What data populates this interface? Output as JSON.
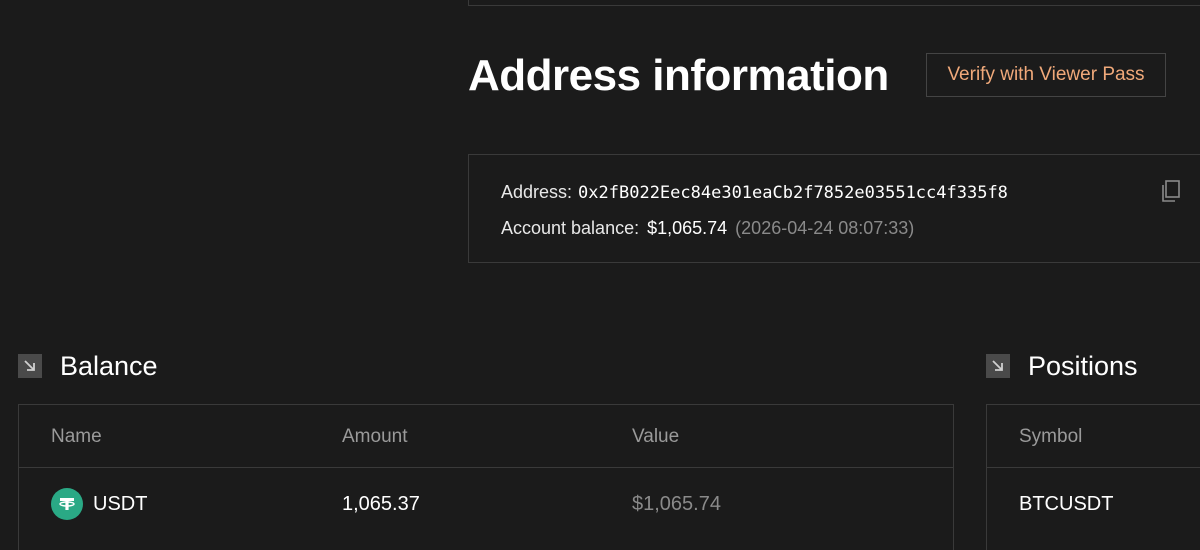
{
  "header": {
    "title": "Address information",
    "verify_label": "Verify with Viewer Pass"
  },
  "address_card": {
    "address_label": "Address:",
    "address_value": "0x2fB022Eec84e301eaCb2f7852e03551cc4f335f8",
    "balance_label": "Account balance:",
    "balance_value": "$1,065.74",
    "balance_time": "(2026-04-24 08:07:33)"
  },
  "balance_section": {
    "title": "Balance",
    "columns": [
      "Name",
      "Amount",
      "Value"
    ],
    "rows": [
      {
        "name": "USDT",
        "amount": "1,065.37",
        "value": "$1,065.74",
        "icon": "tether-icon"
      }
    ]
  },
  "positions_section": {
    "title": "Positions",
    "columns": [
      "Symbol"
    ],
    "rows": [
      {
        "symbol": "BTCUSDT"
      }
    ]
  },
  "colors": {
    "background": "#1b1b1b",
    "accent": "#f0a97a",
    "tether": "#2aa985",
    "border": "#3a3a3a"
  }
}
